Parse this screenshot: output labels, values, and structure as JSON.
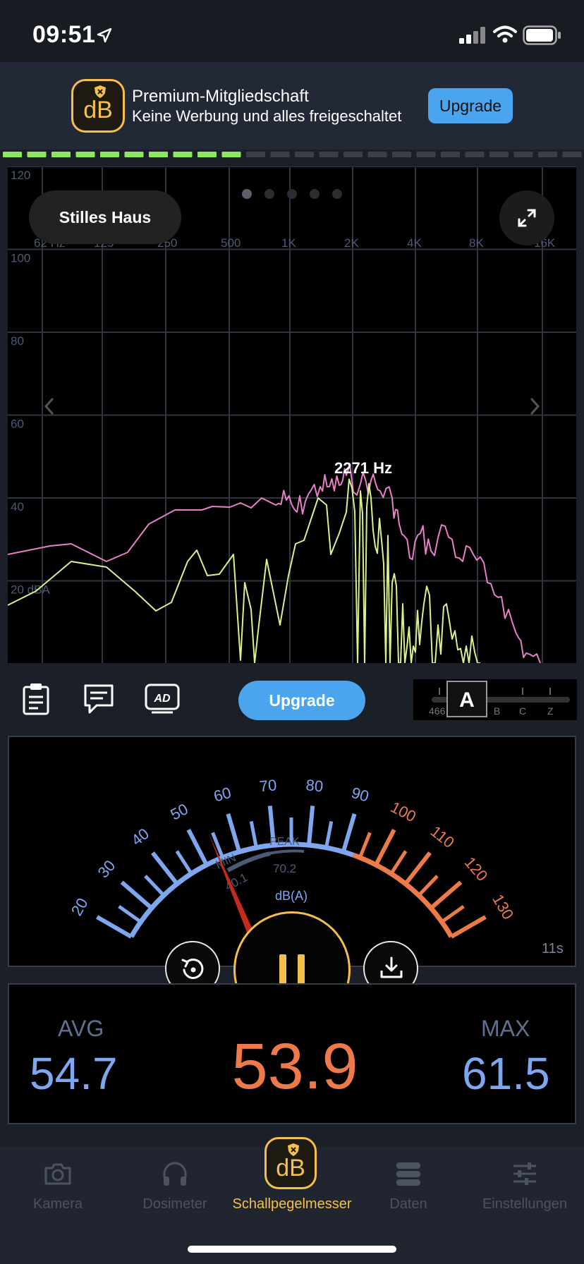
{
  "status_bar": {
    "time": "09:51",
    "icons": [
      "location-arrow-icon",
      "cellular-signal-icon",
      "wifi-icon",
      "battery-icon"
    ]
  },
  "banner": {
    "logo_text": "dB",
    "title": "Premium-Mitgliedschaft",
    "subtitle": "Keine Werbung und alles freigeschaltet",
    "upgrade_label": "Upgrade"
  },
  "level_bar": {
    "fill": 0.41,
    "active_color": "#8ee85c",
    "inactive_color": "#3a3f48"
  },
  "spectrum": {
    "preset_label": "Stilles Haus",
    "peak_label": "2271 Hz",
    "db_ticks": [
      "120",
      "100",
      "80",
      "60",
      "40",
      "20 dBA"
    ],
    "freq_ticks": [
      "62 Hz",
      "125",
      "250",
      "500",
      "1K",
      "2K",
      "4K",
      "8K",
      "16K"
    ],
    "page_dots": 5,
    "active_page": 0,
    "series_colors": {
      "max": "#e87fc9",
      "current": "#d8f28b"
    }
  },
  "toolbar": {
    "icons": [
      "clipboard-icon",
      "comment-icon",
      "ad-icon"
    ],
    "upgrade_label": "Upgrade",
    "weighting": {
      "selected": "A",
      "options": [
        "466",
        "B",
        "C",
        "Z"
      ]
    }
  },
  "meter": {
    "scale_blue": [
      "20",
      "30",
      "40",
      "50",
      "60",
      "70",
      "80",
      "90"
    ],
    "scale_orange": [
      "100",
      "110",
      "120",
      "130"
    ],
    "min_label": "MIN",
    "min_value": "40.1",
    "peak_label": "PEAK",
    "peak_value": "70.2",
    "unit": "dB(A)",
    "needle_value": 54,
    "elapsed": "11s"
  },
  "stats": {
    "avg_label": "AVG",
    "avg_value": "54.7",
    "current_value": "53.9",
    "max_label": "MAX",
    "max_value": "61.5"
  },
  "tabs": [
    {
      "label": "Kamera",
      "icon": "camera-icon",
      "active": false
    },
    {
      "label": "Dosimeter",
      "icon": "headphones-icon",
      "active": false
    },
    {
      "label": "Schallpegelmesser",
      "icon": "db-logo-icon",
      "active": true
    },
    {
      "label": "Daten",
      "icon": "database-icon",
      "active": false
    },
    {
      "label": "Einstellungen",
      "icon": "sliders-icon",
      "active": false
    }
  ],
  "colors": {
    "accent": "#f3c04c",
    "blue": "#4aa5ee",
    "orange": "#ee7a49",
    "scale_blue": "#7ea7ef"
  }
}
